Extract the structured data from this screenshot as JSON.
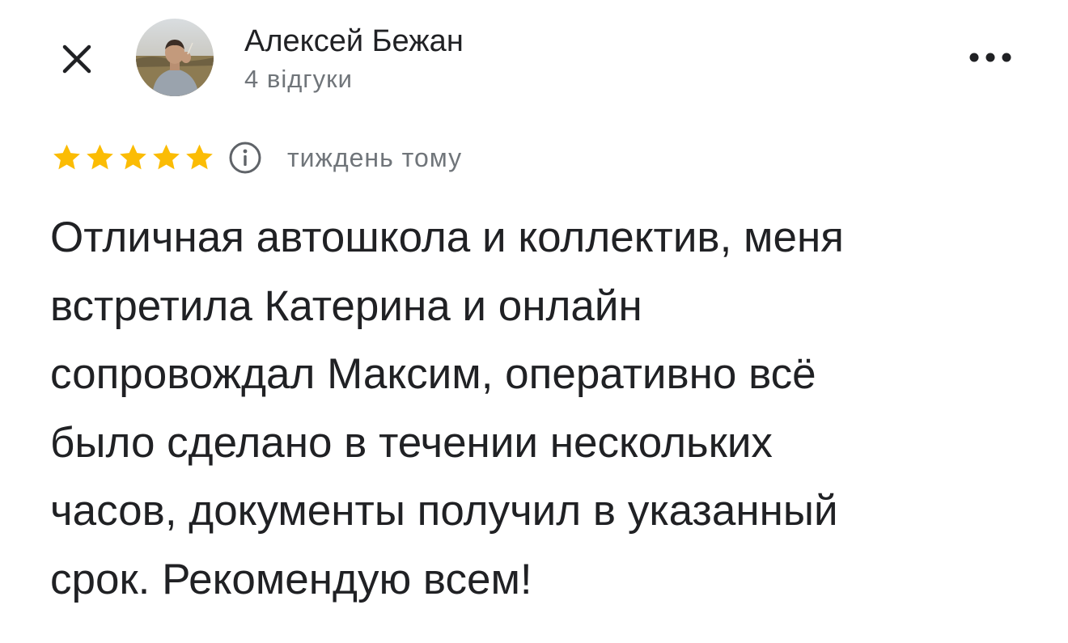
{
  "icons": {
    "close": "close-icon",
    "more": "more-horizontal-icon",
    "info": "info-icon",
    "star": "star-icon"
  },
  "colors": {
    "star": "#fbbc04",
    "secondary_text": "#70757a",
    "primary_text": "#202124"
  },
  "reviewer": {
    "name": "Алексей Бежан",
    "reviews_count": "4 відгуки"
  },
  "review": {
    "rating": 5,
    "max_rating": 5,
    "date": "тиждень тому",
    "text_lines": [
      "Отличная автошкола и коллектив, меня",
      "встретила Катерина и онлайн",
      "сопровождал Максим, оперативно всё",
      "было сделано в течении нескольких",
      "часов, документы получил в указанный",
      "срок. Рекомендую всем!"
    ]
  }
}
